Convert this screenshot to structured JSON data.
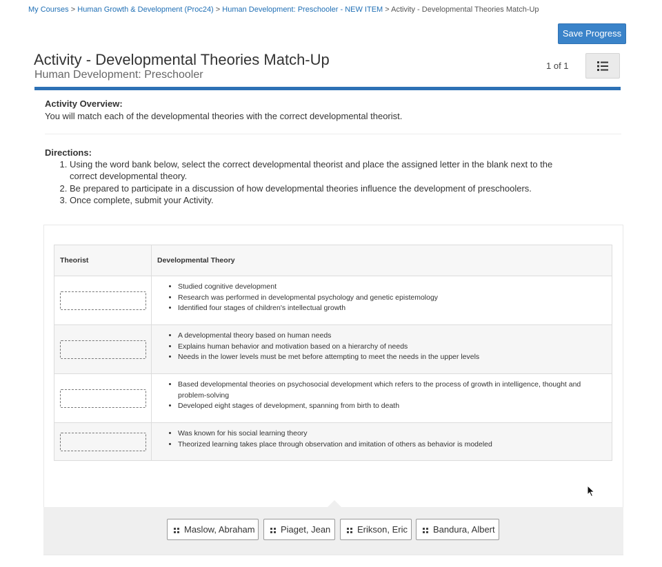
{
  "breadcrumb": {
    "items": [
      "My Courses",
      "Human Growth & Development (Proc24)",
      "Human Development: Preschooler - NEW ITEM"
    ],
    "current": "Activity - Developmental Theories Match-Up",
    "separator": ">"
  },
  "header": {
    "save_label": "Save Progress",
    "title": "Activity - Developmental Theories Match-Up",
    "subtitle": "Human Development: Preschooler",
    "pager": "1 of 1",
    "list_icon": "list-icon"
  },
  "overview": {
    "label": "Activity Overview:",
    "text": "You will match each of the developmental theories with the correct developmental theorist."
  },
  "directions": {
    "label": "Directions:",
    "steps": [
      "Using the word bank below, select the correct developmental theorist and place the assigned letter in the blank next to the correct developmental theory.",
      "Be prepared to participate in a discussion of how developmental theories influence the development of preschoolers.",
      "Once complete, submit your Activity."
    ]
  },
  "table": {
    "headers": [
      "Theorist",
      "Developmental Theory"
    ],
    "rows": [
      {
        "points": [
          "Studied cognitive development",
          "Research was performed in developmental psychology and genetic epistemology",
          "Identified four stages of children's intellectual growth"
        ]
      },
      {
        "points": [
          "A developmental theory based on human needs",
          "Explains human behavior and motivation based on a hierarchy of needs",
          "Needs in the lower levels must be met before attempting to meet the needs in the upper levels"
        ]
      },
      {
        "points": [
          "Based developmental theories on psychosocial development which refers to the process of growth in intelligence, thought and problem-solving",
          "Developed eight stages of development, spanning from birth to death"
        ]
      },
      {
        "points": [
          "Was known for his social learning theory",
          "Theorized learning takes place through observation and imitation of others as behavior is modeled"
        ]
      }
    ]
  },
  "word_bank": [
    "Maslow, Abraham",
    "Piaget, Jean",
    "Erikson, Eric",
    "Bandura, Albert"
  ],
  "colors": {
    "accent": "#2d71b5",
    "button": "#3a83c9",
    "link": "#1f6fb5"
  }
}
